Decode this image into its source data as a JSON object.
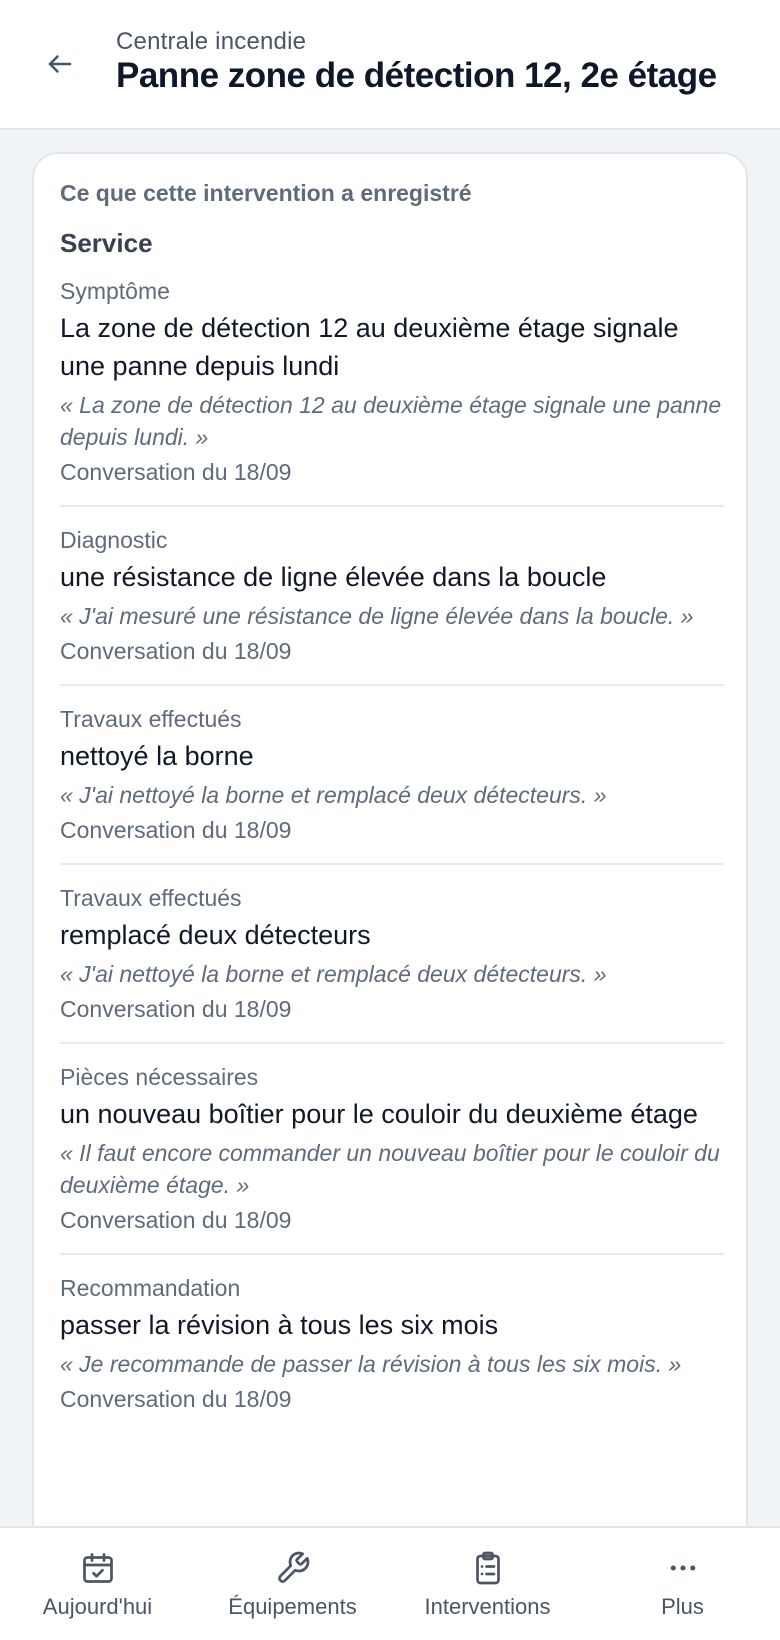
{
  "header": {
    "subtitle": "Centrale incendie",
    "title": "Panne zone de détection 12, 2e étage"
  },
  "card": {
    "heading": "Ce que cette intervention a enregistré",
    "section": "Service",
    "entries": [
      {
        "label": "Symptôme",
        "value": "La zone de détection 12 au deuxième étage signale une panne depuis lundi",
        "quote": "« La zone de détection 12 au deuxième étage signale une panne depuis lundi. »",
        "source": "Conversation du 18/09"
      },
      {
        "label": "Diagnostic",
        "value": "une résistance de ligne élevée dans la boucle",
        "quote": "« J'ai mesuré une résistance de ligne élevée dans la boucle. »",
        "source": "Conversation du 18/09"
      },
      {
        "label": "Travaux effectués",
        "value": "nettoyé la borne",
        "quote": "« J'ai nettoyé la borne et remplacé deux détecteurs. »",
        "source": "Conversation du 18/09"
      },
      {
        "label": "Travaux effectués",
        "value": "remplacé deux détecteurs",
        "quote": "« J'ai nettoyé la borne et remplacé deux détecteurs. »",
        "source": "Conversation du 18/09"
      },
      {
        "label": "Pièces nécessaires",
        "value": "un nouveau boîtier pour le couloir du deuxième étage",
        "quote": "« Il faut encore commander un nouveau boîtier pour le couloir du deuxième étage. »",
        "source": "Conversation du 18/09"
      },
      {
        "label": "Recommandation",
        "value": "passer la révision à tous les six mois",
        "quote": "« Je recommande de passer la révision à tous les six mois. »",
        "source": "Conversation du 18/09"
      }
    ]
  },
  "nav": [
    {
      "label": "Aujourd'hui",
      "icon": "calendar-check-icon"
    },
    {
      "label": "Équipements",
      "icon": "wrench-icon"
    },
    {
      "label": "Interventions",
      "icon": "clipboard-list-icon"
    },
    {
      "label": "Plus",
      "icon": "more-horizontal-icon"
    }
  ]
}
